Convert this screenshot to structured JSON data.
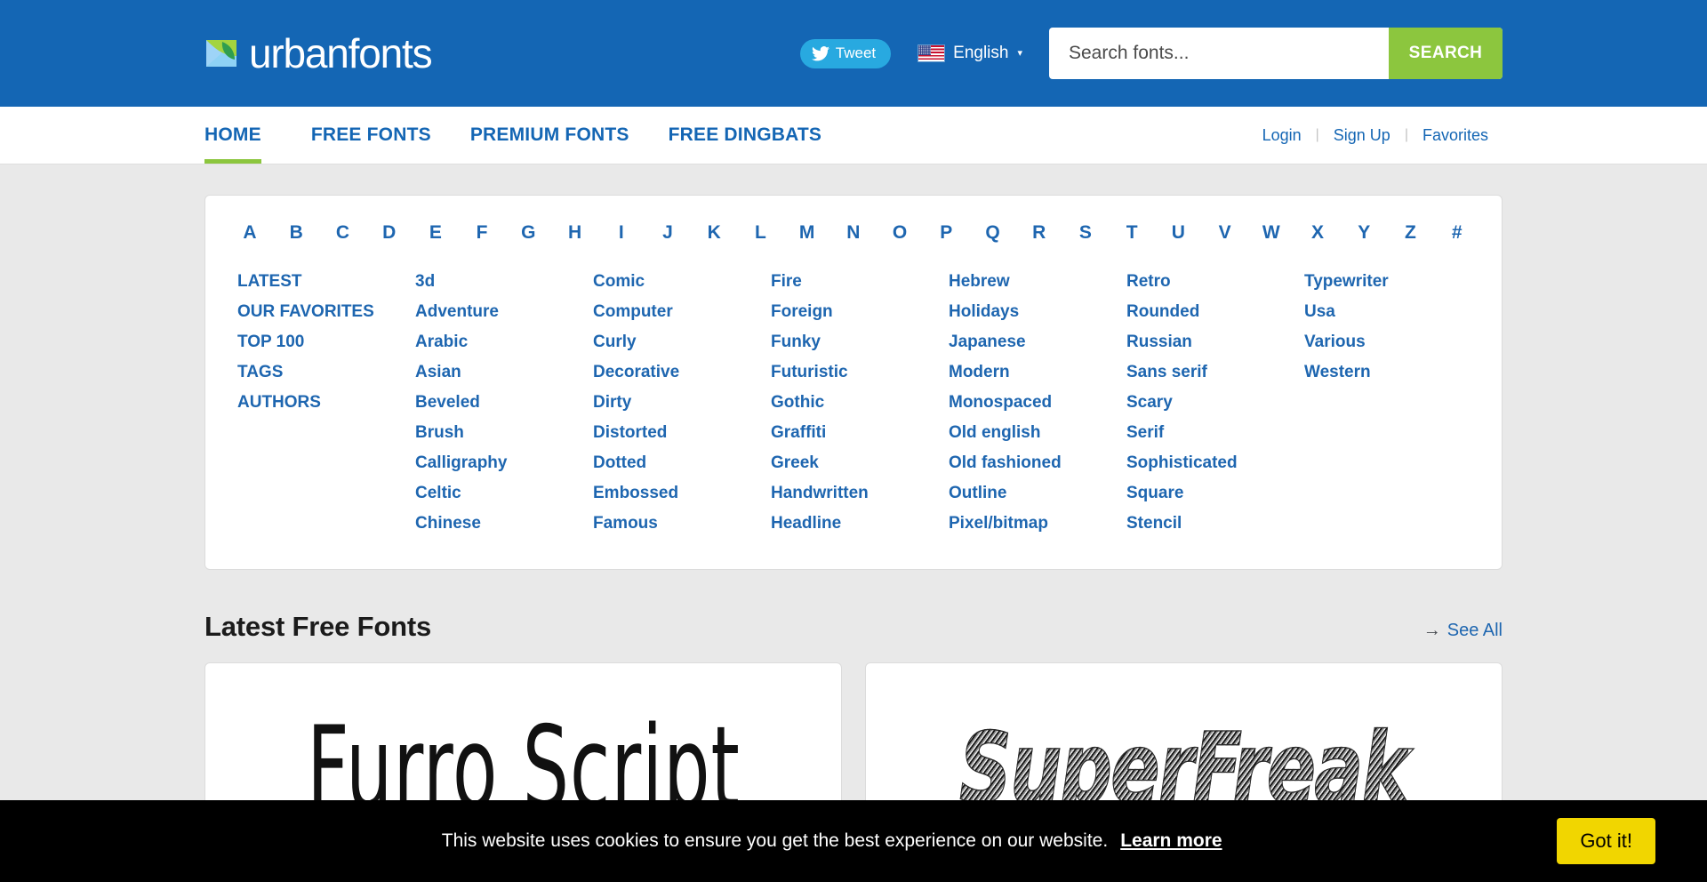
{
  "header": {
    "logo_text": "urbanfonts",
    "tweet_label": "Tweet",
    "language": "English",
    "language_caret": "▾",
    "search_placeholder": "Search fonts...",
    "search_value": "",
    "search_button": "SEARCH",
    "colors": {
      "header_bg": "#1466b4",
      "accent_green": "#8cc63e",
      "twitter_blue": "#28a9e0",
      "link_blue": "#1e66b0"
    }
  },
  "nav": {
    "items": [
      {
        "label": "HOME",
        "active": true
      },
      {
        "label": "FREE FONTS",
        "active": false
      },
      {
        "label": "PREMIUM FONTS",
        "active": false
      },
      {
        "label": "FREE DINGBATS",
        "active": false
      }
    ],
    "account": [
      {
        "label": "Login"
      },
      {
        "label": "Sign Up"
      },
      {
        "label": "Favorites"
      }
    ],
    "separator": "|"
  },
  "categories": {
    "alphabet": [
      "A",
      "B",
      "C",
      "D",
      "E",
      "F",
      "G",
      "H",
      "I",
      "J",
      "K",
      "L",
      "M",
      "N",
      "O",
      "P",
      "Q",
      "R",
      "S",
      "T",
      "U",
      "V",
      "W",
      "X",
      "Y",
      "Z",
      "#"
    ],
    "columns": [
      {
        "caps": true,
        "items": [
          "LATEST",
          "OUR FAVORITES",
          "TOP 100",
          "TAGS",
          "AUTHORS"
        ]
      },
      {
        "caps": false,
        "items": [
          "3d",
          "Adventure",
          "Arabic",
          "Asian",
          "Beveled",
          "Brush",
          "Calligraphy",
          "Celtic",
          "Chinese"
        ]
      },
      {
        "caps": false,
        "items": [
          "Comic",
          "Computer",
          "Curly",
          "Decorative",
          "Dirty",
          "Distorted",
          "Dotted",
          "Embossed",
          "Famous"
        ]
      },
      {
        "caps": false,
        "items": [
          "Fire",
          "Foreign",
          "Funky",
          "Futuristic",
          "Gothic",
          "Graffiti",
          "Greek",
          "Handwritten",
          "Headline"
        ]
      },
      {
        "caps": false,
        "items": [
          "Hebrew",
          "Holidays",
          "Japanese",
          "Modern",
          "Monospaced",
          "Old english",
          "Old fashioned",
          "Outline",
          "Pixel/bitmap"
        ]
      },
      {
        "caps": false,
        "items": [
          "Retro",
          "Rounded",
          "Russian",
          "Sans serif",
          "Scary",
          "Serif",
          "Sophisticated",
          "Square",
          "Stencil"
        ]
      },
      {
        "caps": false,
        "items": [
          "Typewriter",
          "Usa",
          "Various",
          "Western"
        ]
      }
    ]
  },
  "latest": {
    "title": "Latest Free Fonts",
    "see_all_arrow": "→",
    "see_all_label": "See All",
    "cards": [
      {
        "preview_text": "Furro Script",
        "style": "handwritten"
      },
      {
        "preview_text": "SuperFreak",
        "style": "sketch-bold"
      }
    ]
  },
  "cookie": {
    "message": "This website uses cookies to ensure you get the best experience on our website.",
    "learn_more": "Learn more",
    "accept_label": "Got it!",
    "button_color": "#f1d600"
  }
}
